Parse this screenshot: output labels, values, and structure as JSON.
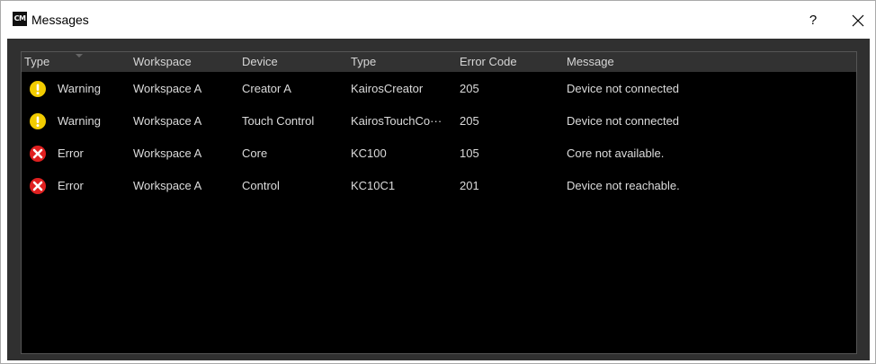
{
  "window": {
    "logo_text": "CM",
    "title": "Messages",
    "help_label": "?"
  },
  "table": {
    "columns": [
      "Type",
      "Workspace",
      "Device",
      "Type",
      "Error Code",
      "Message"
    ],
    "rows": [
      {
        "severity": "warning",
        "icon": "warning-icon",
        "type": "Warning",
        "workspace": "Workspace A",
        "device": "Creator A",
        "device_type": "KairosCreator",
        "error_code": "205",
        "message": "Device not connected"
      },
      {
        "severity": "warning",
        "icon": "warning-icon",
        "type": "Warning",
        "workspace": "Workspace A",
        "device": "Touch Control",
        "device_type": "KairosTouchCo···",
        "error_code": "205",
        "message": "Device not connected"
      },
      {
        "severity": "error",
        "icon": "error-icon",
        "type": "Error",
        "workspace": "Workspace A",
        "device": "Core",
        "device_type": "KC100",
        "error_code": "105",
        "message": "Core not available."
      },
      {
        "severity": "error",
        "icon": "error-icon",
        "type": "Error",
        "workspace": "Workspace A",
        "device": "Control",
        "device_type": "KC10C1",
        "error_code": "201",
        "message": "Device not reachable."
      }
    ]
  },
  "colors": {
    "warning": "#f2cc00",
    "error": "#e02020",
    "panel_bg": "#000000",
    "header_bg": "#323232",
    "frame_bg": "#303030"
  }
}
